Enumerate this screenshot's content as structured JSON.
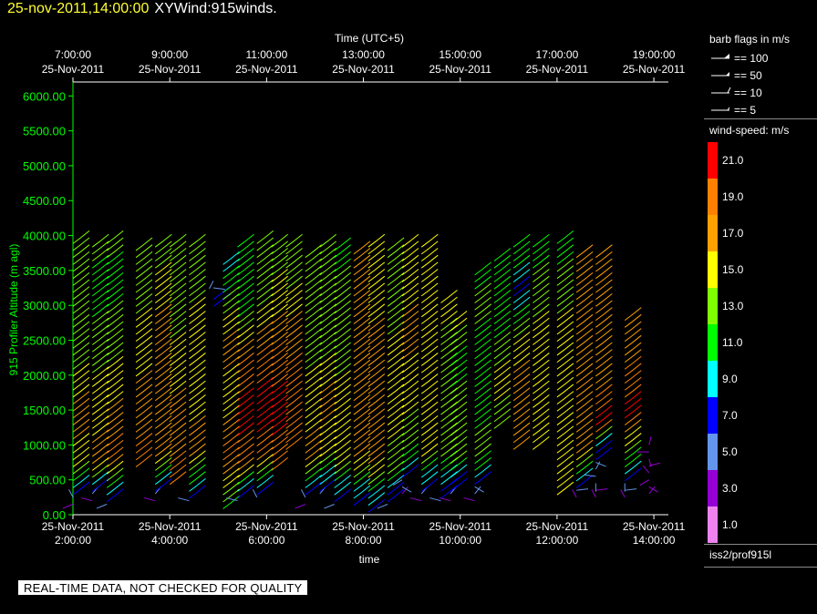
{
  "header": {
    "timestamp": "25-nov-2011,14:00:00",
    "product": "XYWind:915winds."
  },
  "chart_data": {
    "type": "wind-barb time-height",
    "top_axis_title": "Time (UTC+5)",
    "top_tick_labels": [
      [
        "7:00:00",
        "25-Nov-2011"
      ],
      [
        "9:00:00",
        "25-Nov-2011"
      ],
      [
        "11:00:00",
        "25-Nov-2011"
      ],
      [
        "13:00:00",
        "25-Nov-2011"
      ],
      [
        "15:00:00",
        "25-Nov-2011"
      ],
      [
        "17:00:00",
        "25-Nov-2011"
      ],
      [
        "19:00:00",
        "25-Nov-2011"
      ]
    ],
    "xlabel": "time",
    "bottom_tick_labels": [
      [
        "25-Nov-2011",
        "2:00:00"
      ],
      [
        "25-Nov-2011",
        "4:00:00"
      ],
      [
        "25-Nov-2011",
        "6:00:00"
      ],
      [
        "25-Nov-2011",
        "8:00:00"
      ],
      [
        "25-Nov-2011",
        "10:00:00"
      ],
      [
        "25-Nov-2011",
        "12:00:00"
      ],
      [
        "25-Nov-2011",
        "14:00:00"
      ]
    ],
    "xlim_hours_utc": [
      2.0,
      14.3
    ],
    "ylabel": "915 Profiler Altitude (m agl)",
    "ylim": [
      0,
      6200
    ],
    "y_tick_labels": [
      "0.00",
      "500.00",
      "1000.00",
      "1500.00",
      "2000.00",
      "2500.00",
      "3000.00",
      "3500.00",
      "4000.00",
      "4500.00",
      "5000.00",
      "5500.00",
      "6000.00"
    ],
    "y_tick_values": [
      0,
      500,
      1000,
      1500,
      2000,
      2500,
      3000,
      3500,
      4000,
      4500,
      5000,
      5500,
      6000
    ],
    "barb_legend_title": "barb flags in m/s",
    "barb_legend": [
      "== 100",
      "== 50",
      "== 10",
      "== 5"
    ],
    "speed_legend_title": "wind-speed: m/s",
    "speed_scale": [
      {
        "label": "21.0",
        "color": "#ff0000"
      },
      {
        "label": "19.0",
        "color": "#ff8000"
      },
      {
        "label": "17.0",
        "color": "#ffa000"
      },
      {
        "label": "15.0",
        "color": "#ffff00"
      },
      {
        "label": "13.0",
        "color": "#80ff00"
      },
      {
        "label": "11.0",
        "color": "#00ff00"
      },
      {
        "label": "9.0",
        "color": "#00ffff"
      },
      {
        "label": "7.0",
        "color": "#0000ff"
      },
      {
        "label": "5.0",
        "color": "#6495ed"
      },
      {
        "label": "3.0",
        "color": "#9400d3"
      },
      {
        "label": "1.0",
        "color": "#ee82ee"
      }
    ],
    "profiles": [
      {
        "t": 2.0,
        "bottom": 150,
        "top": 3950,
        "speeds": [
          [
            150,
            3
          ],
          [
            700,
            15
          ],
          [
            1500,
            17
          ],
          [
            2300,
            13
          ],
          [
            3000,
            13
          ],
          [
            3950,
            13
          ]
        ]
      },
      {
        "t": 2.4,
        "bottom": 200,
        "top": 3900,
        "speeds": [
          [
            200,
            3
          ],
          [
            800,
            17
          ],
          [
            1600,
            15
          ],
          [
            2500,
            13
          ],
          [
            3300,
            11
          ],
          [
            3900,
            13
          ]
        ]
      },
      {
        "t": 2.7,
        "bottom": 150,
        "top": 4000,
        "speeds": [
          [
            150,
            5
          ],
          [
            900,
            19
          ],
          [
            1800,
            15
          ],
          [
            2600,
            13
          ],
          [
            3400,
            11
          ],
          [
            4000,
            13
          ]
        ]
      },
      {
        "t": 3.3,
        "bottom": 750,
        "top": 3900,
        "speeds": [
          [
            750,
            19
          ],
          [
            1500,
            17
          ],
          [
            2500,
            15
          ],
          [
            3300,
            13
          ],
          [
            3900,
            13
          ]
        ]
      },
      {
        "t": 3.7,
        "bottom": 200,
        "top": 3900,
        "speeds": [
          [
            200,
            3
          ],
          [
            900,
            17
          ],
          [
            1800,
            17
          ],
          [
            2600,
            17
          ],
          [
            3300,
            15
          ],
          [
            3900,
            13
          ]
        ]
      },
      {
        "t": 4.0,
        "bottom": 500,
        "top": 3900,
        "speeds": [
          [
            500,
            19
          ],
          [
            1300,
            17
          ],
          [
            2200,
            15
          ],
          [
            3000,
            13
          ],
          [
            3900,
            13
          ]
        ]
      },
      {
        "t": 4.4,
        "bottom": 200,
        "top": 3900,
        "speeds": [
          [
            200,
            5
          ],
          [
            900,
            17
          ],
          [
            1900,
            15
          ],
          [
            2700,
            15
          ],
          [
            3400,
            13
          ],
          [
            3900,
            13
          ]
        ]
      },
      {
        "t": 4.9,
        "bottom": 3050,
        "top": 3350,
        "speeds": [
          [
            3050,
            7
          ],
          [
            3350,
            5
          ]
        ]
      },
      {
        "t": 5.1,
        "bottom": 150,
        "top": 3700,
        "speeds": [
          [
            150,
            11
          ],
          [
            900,
            19
          ],
          [
            1600,
            15
          ],
          [
            2500,
            17
          ],
          [
            3100,
            13
          ],
          [
            3700,
            9
          ]
        ]
      },
      {
        "t": 5.4,
        "bottom": 200,
        "top": 3900,
        "speeds": [
          [
            200,
            5
          ],
          [
            800,
            19
          ],
          [
            1400,
            21
          ],
          [
            2200,
            19
          ],
          [
            3000,
            11
          ],
          [
            3900,
            11
          ]
        ]
      },
      {
        "t": 5.8,
        "bottom": 250,
        "top": 3950,
        "speeds": [
          [
            250,
            5
          ],
          [
            900,
            19
          ],
          [
            1500,
            21
          ],
          [
            2300,
            19
          ],
          [
            3100,
            13
          ],
          [
            3950,
            13
          ]
        ]
      },
      {
        "t": 6.1,
        "bottom": 700,
        "top": 3950,
        "speeds": [
          [
            700,
            19
          ],
          [
            1500,
            21
          ],
          [
            2300,
            19
          ],
          [
            3000,
            15
          ],
          [
            3950,
            13
          ]
        ]
      },
      {
        "t": 6.4,
        "bottom": 1000,
        "top": 3900,
        "speeds": [
          [
            1000,
            19
          ],
          [
            1800,
            19
          ],
          [
            2700,
            17
          ],
          [
            3400,
            13
          ],
          [
            3900,
            13
          ]
        ]
      },
      {
        "t": 6.8,
        "bottom": 150,
        "top": 3800,
        "speeds": [
          [
            150,
            3
          ],
          [
            800,
            17
          ],
          [
            1700,
            15
          ],
          [
            2500,
            13
          ],
          [
            3200,
            13
          ],
          [
            3800,
            13
          ]
        ]
      },
      {
        "t": 7.1,
        "bottom": 300,
        "top": 3900,
        "speeds": [
          [
            300,
            5
          ],
          [
            900,
            15
          ],
          [
            1700,
            17
          ],
          [
            2500,
            13
          ],
          [
            3300,
            13
          ],
          [
            3900,
            13
          ]
        ]
      },
      {
        "t": 7.4,
        "bottom": 150,
        "top": 3850,
        "speeds": [
          [
            150,
            5
          ],
          [
            800,
            15
          ],
          [
            1600,
            15
          ],
          [
            2400,
            13
          ],
          [
            3200,
            13
          ],
          [
            3850,
            11
          ]
        ]
      },
      {
        "t": 7.8,
        "bottom": 200,
        "top": 3850,
        "speeds": [
          [
            200,
            7
          ],
          [
            900,
            17
          ],
          [
            1700,
            17
          ],
          [
            2500,
            17
          ],
          [
            3300,
            17
          ],
          [
            3850,
            17
          ]
        ]
      },
      {
        "t": 8.1,
        "bottom": 100,
        "top": 3900,
        "speeds": [
          [
            100,
            7
          ],
          [
            800,
            17
          ],
          [
            1600,
            17
          ],
          [
            2400,
            17
          ],
          [
            3200,
            15
          ],
          [
            3900,
            15
          ]
        ]
      },
      {
        "t": 8.5,
        "bottom": 150,
        "top": 3850,
        "speeds": [
          [
            150,
            5
          ],
          [
            700,
            13
          ],
          [
            1400,
            15
          ],
          [
            2200,
            15
          ],
          [
            3000,
            13
          ],
          [
            3850,
            13
          ]
        ]
      },
      {
        "t": 8.8,
        "bottom": 300,
        "top": 3900,
        "speeds": [
          [
            300,
            3
          ],
          [
            1000,
            13
          ],
          [
            1800,
            15
          ],
          [
            2600,
            17
          ],
          [
            3300,
            15
          ],
          [
            3900,
            15
          ]
        ]
      },
      {
        "t": 9.2,
        "bottom": 200,
        "top": 3950,
        "speeds": [
          [
            200,
            3
          ],
          [
            900,
            15
          ],
          [
            1700,
            15
          ],
          [
            2500,
            15
          ],
          [
            3300,
            15
          ],
          [
            3950,
            15
          ]
        ]
      },
      {
        "t": 9.6,
        "bottom": 200,
        "top": 3100,
        "speeds": [
          [
            200,
            5
          ],
          [
            900,
            13
          ],
          [
            1600,
            13
          ],
          [
            2300,
            13
          ],
          [
            3100,
            15
          ]
        ]
      },
      {
        "t": 9.8,
        "bottom": 200,
        "top": 2800,
        "speeds": [
          [
            200,
            3
          ],
          [
            800,
            13
          ],
          [
            1500,
            13
          ],
          [
            2200,
            11
          ],
          [
            2800,
            15
          ]
        ]
      },
      {
        "t": 10.3,
        "bottom": 200,
        "top": 3500,
        "speeds": [
          [
            200,
            3
          ],
          [
            900,
            13
          ],
          [
            1700,
            11
          ],
          [
            2500,
            11
          ],
          [
            3000,
            13
          ],
          [
            3500,
            11
          ]
        ]
      },
      {
        "t": 10.7,
        "bottom": 1300,
        "top": 3750,
        "speeds": [
          [
            1300,
            13
          ],
          [
            2000,
            15
          ],
          [
            2800,
            11
          ],
          [
            3300,
            11
          ],
          [
            3750,
            11
          ]
        ]
      },
      {
        "t": 11.1,
        "bottom": 1000,
        "top": 3950,
        "speeds": [
          [
            1000,
            17
          ],
          [
            1800,
            17
          ],
          [
            2500,
            15
          ],
          [
            3200,
            7
          ],
          [
            3600,
            11
          ],
          [
            3950,
            11
          ]
        ]
      },
      {
        "t": 11.5,
        "bottom": 1000,
        "top": 3900,
        "speeds": [
          [
            1000,
            15
          ],
          [
            1800,
            15
          ],
          [
            2500,
            15
          ],
          [
            3200,
            13
          ],
          [
            3900,
            11
          ]
        ]
      },
      {
        "t": 12.0,
        "bottom": 350,
        "top": 3950,
        "speeds": [
          [
            350,
            15
          ],
          [
            1000,
            15
          ],
          [
            1800,
            15
          ],
          [
            2600,
            15
          ],
          [
            3300,
            13
          ],
          [
            3950,
            11
          ]
        ]
      },
      {
        "t": 12.4,
        "bottom": 250,
        "top": 3750,
        "speeds": [
          [
            250,
            3
          ],
          [
            900,
            17
          ],
          [
            1700,
            17
          ],
          [
            2500,
            17
          ],
          [
            3200,
            17
          ],
          [
            3750,
            17
          ]
        ]
      },
      {
        "t": 12.8,
        "bottom": 250,
        "top": 3800,
        "speeds": [
          [
            250,
            3
          ],
          [
            1000,
            7
          ],
          [
            1300,
            21
          ],
          [
            2000,
            17
          ],
          [
            2900,
            17
          ],
          [
            3800,
            17
          ]
        ]
      },
      {
        "t": 13.4,
        "bottom": 250,
        "top": 2850,
        "speeds": [
          [
            250,
            3
          ],
          [
            1500,
            21
          ],
          [
            2400,
            17
          ],
          [
            2850,
            17
          ]
        ]
      },
      {
        "t": 13.9,
        "bottom": 300,
        "top": 1000,
        "speeds": [
          [
            300,
            3
          ],
          [
            1000,
            3
          ]
        ]
      }
    ]
  },
  "quality_banner": "REAL-TIME DATA, NOT CHECKED FOR QUALITY",
  "source_label": "iss2/prof915l"
}
